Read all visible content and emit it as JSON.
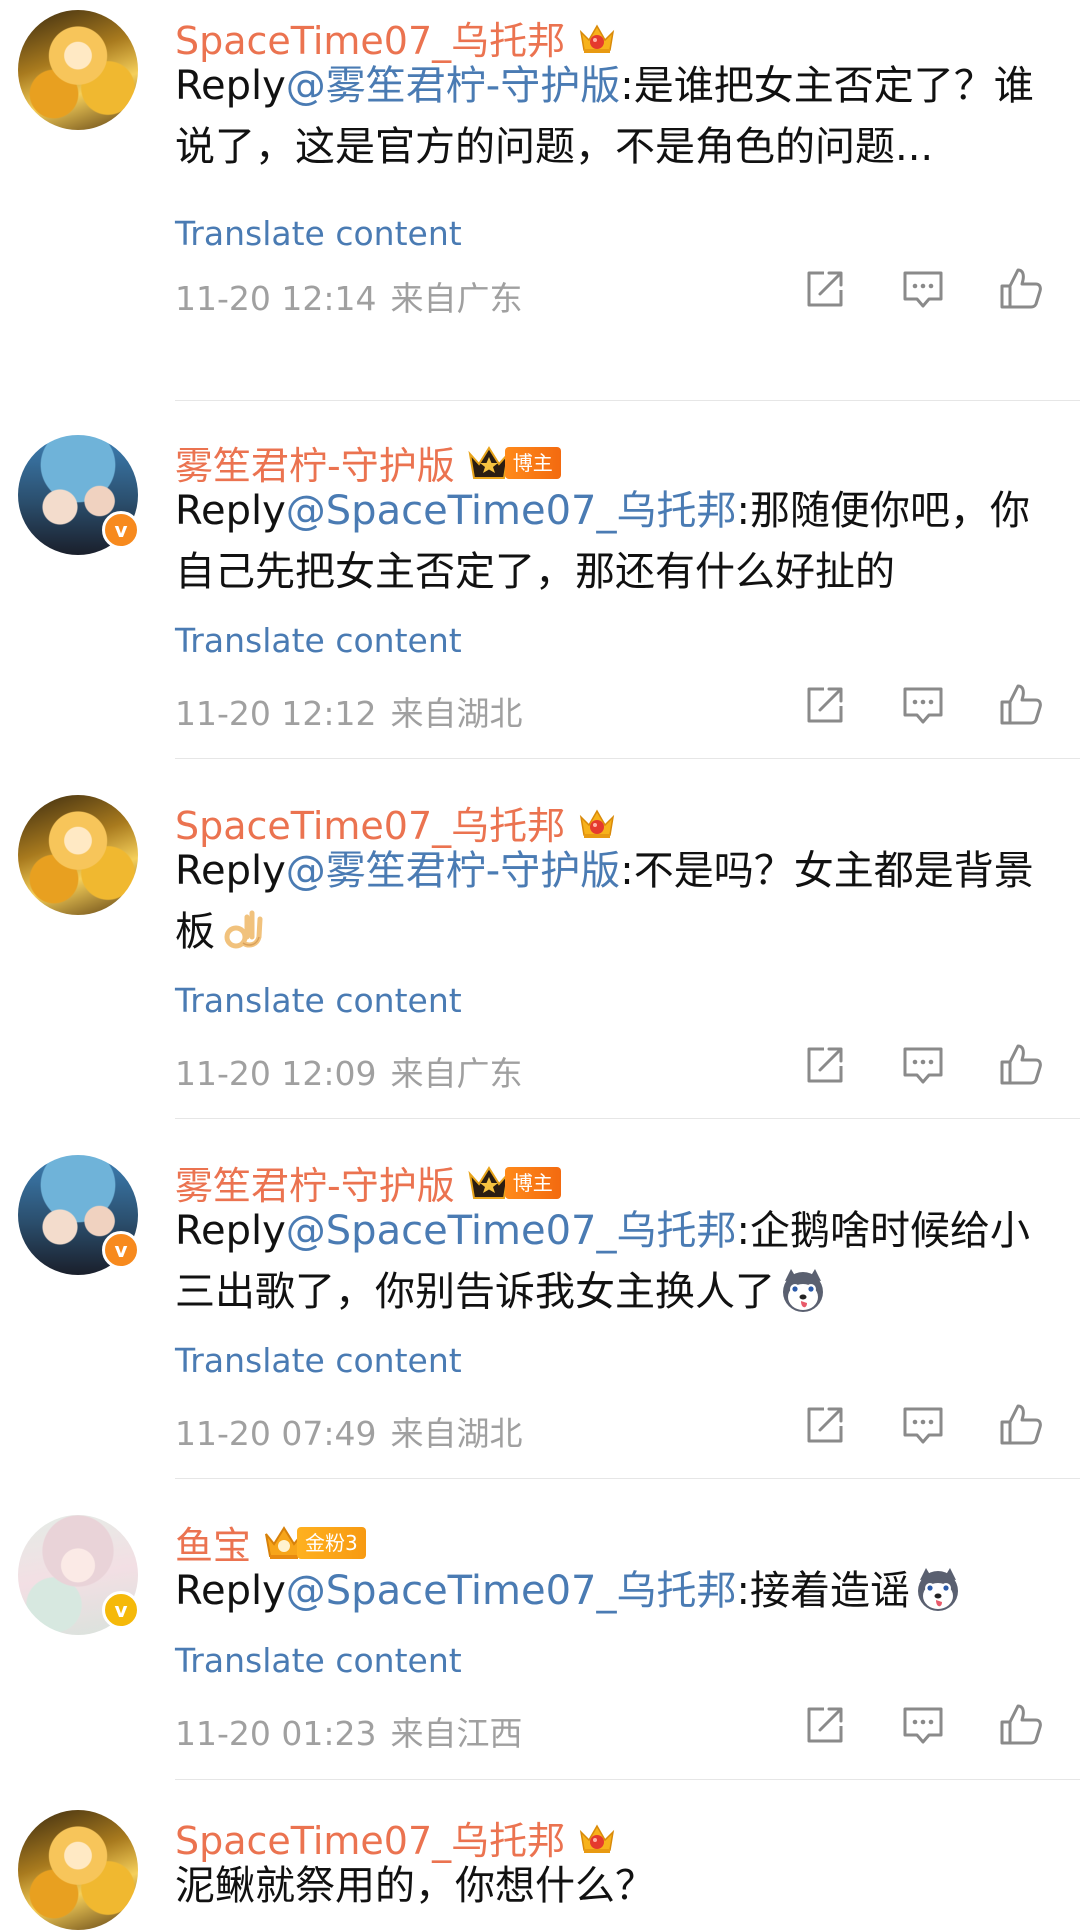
{
  "ui": {
    "translate_label": "Translate content",
    "reply_prefix": "Reply",
    "badge_blogger": "博主",
    "badge_fan": "金粉3"
  },
  "colors": {
    "username": "#eb7350",
    "mention": "#4a7bb3",
    "meta": "#a0a0a0",
    "verified_orange": "#f78a1e",
    "verified_yellow": "#f5b90a"
  },
  "comments": [
    {
      "username": "SpaceTime07_乌托邦",
      "badge_icon": "crown-gem-icon",
      "mention": "@雾笙君柠-守护版",
      "body": ":是谁把女主否定了？谁说了，这是官方的问题，不是角色的问题...",
      "date": "11-20 12:14",
      "location": "来自广东"
    },
    {
      "username": "雾笙君柠-守护版",
      "badge_icon": "blogger-crown-icon",
      "verified": "v",
      "mention": "@SpaceTime07_乌托邦",
      "body": ":那随便你吧，你自己先把女主否定了，那还有什么好扯的",
      "date": "11-20 12:12",
      "location": "来自湖北"
    },
    {
      "username": "SpaceTime07_乌托邦",
      "badge_icon": "crown-gem-icon",
      "mention": "@雾笙君柠-守护版",
      "body": ":不是吗？女主都是背景板",
      "emoji": "ok-hand-emoji",
      "date": "11-20 12:09",
      "location": "来自广东"
    },
    {
      "username": "雾笙君柠-守护版",
      "badge_icon": "blogger-crown-icon",
      "verified": "v",
      "mention": "@SpaceTime07_乌托邦",
      "body": ":企鹅啥时候给小三出歌了，你别告诉我女主换人了",
      "emoji": "husky-emoji",
      "date": "11-20 07:49",
      "location": "来自湖北"
    },
    {
      "username": "鱼宝",
      "badge_icon": "fan-crown-icon",
      "verified": "v",
      "mention": "@SpaceTime07_乌托邦",
      "body": ":接着造谣",
      "emoji": "husky-emoji",
      "date": "11-20 01:23",
      "location": "来自江西"
    },
    {
      "username": "SpaceTime07_乌托邦",
      "badge_icon": "crown-gem-icon",
      "body": "泥鳅就祭用的，你想什么？"
    }
  ]
}
